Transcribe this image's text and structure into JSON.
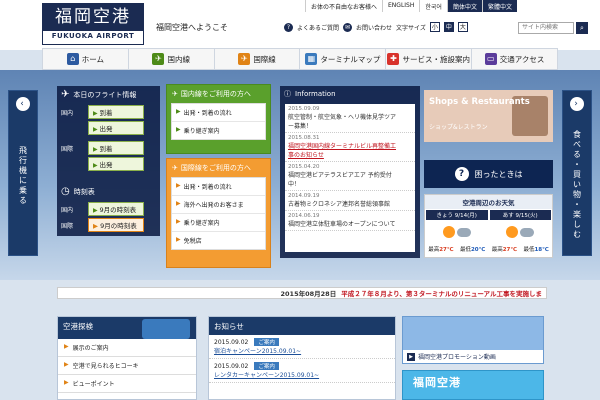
{
  "header": {
    "logo_jp": "福岡空港",
    "logo_en": "FUKUOKA AIRPORT",
    "welcome": "福岡空港へようこそ",
    "top_links": [
      "お体の不自由なお客様へ",
      "ENGLISH",
      "한국어",
      "簡体中文",
      "繁體中文"
    ],
    "faq": "よくあるご質問",
    "contact": "お問い合わせ",
    "font_size_label": "文字サイズ",
    "font_sizes": [
      "小",
      "中",
      "大"
    ],
    "search_placeholder": "サイト内検索"
  },
  "nav": {
    "items": [
      {
        "label": "ホーム",
        "color": "#2d5aa0"
      },
      {
        "label": "国内線",
        "color": "#4d8a17"
      },
      {
        "label": "国際線",
        "color": "#e08316"
      },
      {
        "label": "ターミナルマップ",
        "color": "#3a7abd"
      },
      {
        "label": "サービス・施設案内",
        "color": "#d8322b"
      },
      {
        "label": "交通アクセス",
        "color": "#5b3c9b"
      }
    ]
  },
  "side": {
    "left": "飛行機に乗る",
    "right": "食べる・買い物・楽しむ"
  },
  "flight": {
    "title": "本日のフライト情報",
    "domestic": "国内",
    "international": "国際",
    "arrival": "到着",
    "departure": "出発",
    "timetable_title": "時刻表",
    "tt_domestic": "国内",
    "tt_international": "国際",
    "tt_link": "9月の時刻表"
  },
  "domestic_panel": {
    "title": "国内線をご利用の方へ",
    "items": [
      "出発・到着の流れ",
      "乗り継ぎ案内"
    ]
  },
  "intl_panel": {
    "title": "国際線をご利用の方へ",
    "items": [
      "出発・到着の流れ",
      "海外へ出発のお客さま",
      "乗り継ぎ案内",
      "免税店"
    ]
  },
  "info": {
    "title": "Information",
    "news": [
      {
        "date": "2015.09.09",
        "text": "航空管制・航空気象・ヘリ機体見学ツア",
        "red": false
      },
      {
        "date": "",
        "text": "ー募集！",
        "red": false
      },
      {
        "date": "2015.08.31",
        "text": "福岡空港国内線ターミナルビル再整備工",
        "red": true
      },
      {
        "date": "",
        "text": "事のお知らせ",
        "red": true
      },
      {
        "date": "2015.04.20",
        "text": "福岡空港ビアテラスビアエア 予約受付",
        "red": false
      },
      {
        "date": "",
        "text": "中！",
        "red": false
      },
      {
        "date": "2014.09.19",
        "text": "古着物ミクロネシア連邦名誉総領事館",
        "red": false
      },
      {
        "date": "2014.06.19",
        "text": "福岡空港立体駐車場のオープンについて",
        "red": false
      }
    ]
  },
  "shops": {
    "title": "Shops & Restaurants",
    "sub": "ショップ&レストラン"
  },
  "trouble": {
    "label": "困ったときは",
    "q": "?"
  },
  "weather": {
    "title": "空港周辺のお天気",
    "days": [
      {
        "label": "きょう 9/14(月)",
        "hi_label": "最高",
        "hi": "27℃",
        "lo_label": "最低",
        "lo": "20℃"
      },
      {
        "label": "あす 9/15(火)",
        "hi_label": "最高",
        "hi": "27℃",
        "lo_label": "最低",
        "lo": "18℃"
      }
    ]
  },
  "ticker": {
    "date": "2015年08月28日",
    "message": "平成２７年８月より、第３ターミナルのリニューアル工事を実施しま"
  },
  "explore": {
    "title": "空港探検",
    "items": [
      "展示のご案内",
      "空港で見られるヒコーキ",
      "ビューポイント"
    ]
  },
  "notices": {
    "title": "お知らせ",
    "items": [
      {
        "date": "2015.09.02",
        "tag": "ご案内",
        "link": "宿泊キャンペーン2015.09.01~"
      },
      {
        "date": "2015.09.02",
        "tag": "ご案内",
        "link": "レンタカーキャンペーン2015.09.01~"
      }
    ]
  },
  "promo": {
    "label": "福岡空港プロモーション動画",
    "banner": "福岡空港"
  }
}
